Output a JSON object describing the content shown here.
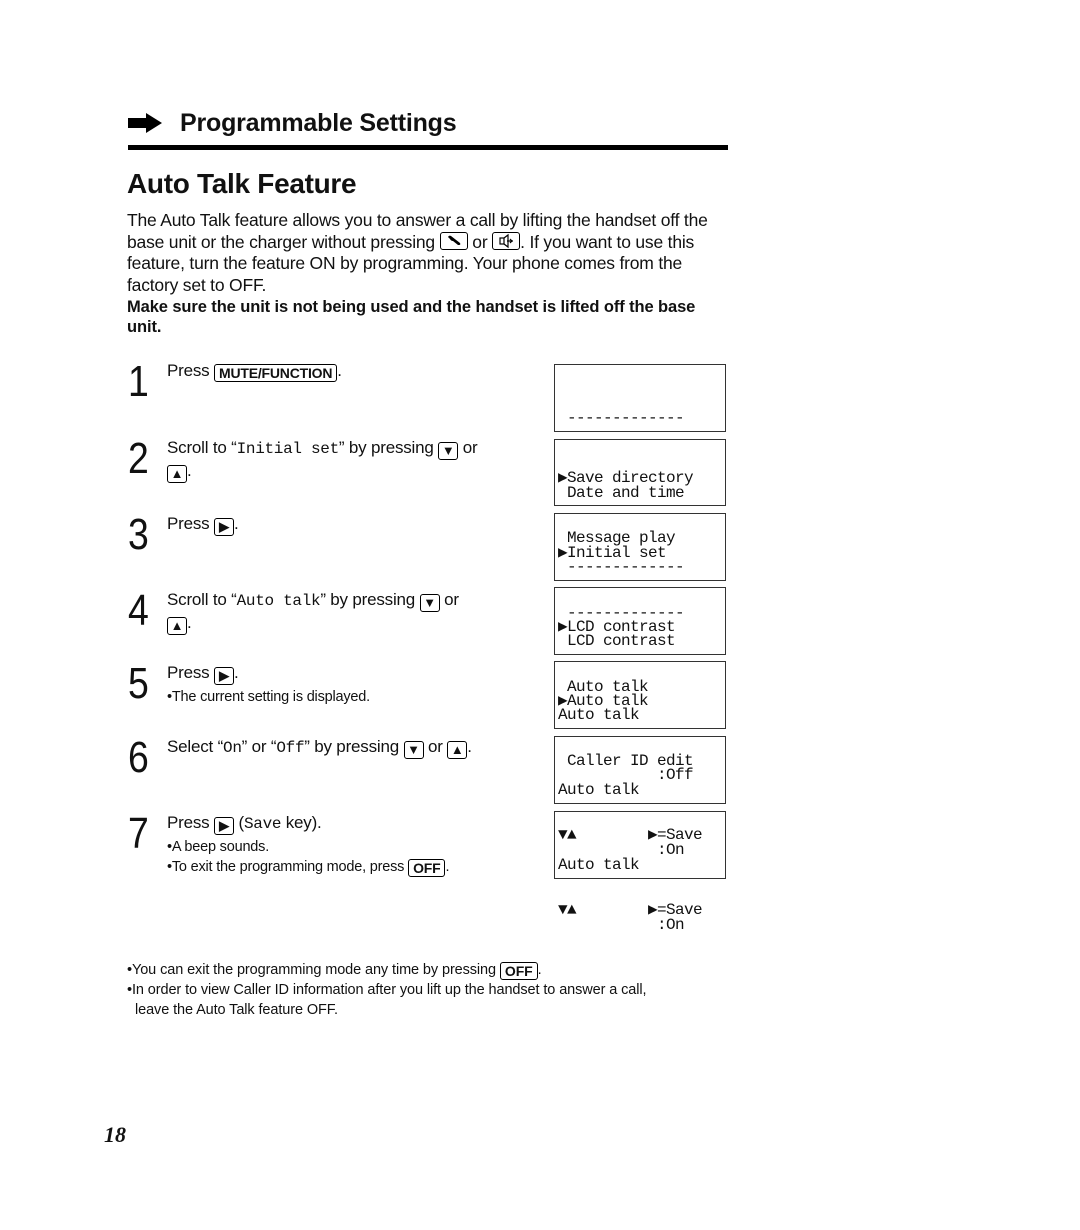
{
  "section": {
    "arrow_icon": "right-arrow-icon",
    "title": "Programmable Settings"
  },
  "page_title": "Auto Talk Feature",
  "intro": {
    "p1_a": "The Auto Talk feature allows you to answer a call by lifting the handset off the base unit or the charger without pressing ",
    "talk_key_icon": "phone-talk-icon",
    "or": " or ",
    "speaker_key_icon": "speakerphone-icon",
    "p1_b": ". If you want to use this feature, turn the feature ON by programming. Your phone comes from the factory set to OFF.",
    "warning": "Make sure the unit is not being used and the handset is lifted off the base unit."
  },
  "keys": {
    "mute_function": "MUTE/FUNCTION",
    "off": "OFF",
    "down": "▼",
    "up": "▲",
    "right": "▶"
  },
  "steps": [
    {
      "number": "1",
      "text_a": "Press ",
      "text_b": "."
    },
    {
      "number": "2",
      "text_a": "Scroll to “",
      "mono": "Initial set",
      "text_b": "” by pressing ",
      "text_c": " or ",
      "text_d": "."
    },
    {
      "number": "3",
      "text_a": "Press ",
      "text_b": "."
    },
    {
      "number": "4",
      "text_a": "Scroll to “",
      "mono": "Auto talk",
      "text_b": "” by pressing ",
      "text_c": " or ",
      "text_d": "."
    },
    {
      "number": "5",
      "text_a": "Press ",
      "text_b": ".",
      "note": "•The current setting is displayed."
    },
    {
      "number": "6",
      "text_a": "Select “",
      "mono1": "On",
      "text_b": "” or “",
      "mono2": "Off",
      "text_c": "” by pressing ",
      "text_d": " or ",
      "text_e": "."
    },
    {
      "number": "7",
      "text_a": "Press ",
      "text_b": " (",
      "mono": "Save",
      "text_c": " key).",
      "note1": "•A beep sounds.",
      "note2_a": "•To exit the programming mode, press ",
      "note2_b": "."
    }
  ],
  "displays": [
    {
      "lines": [
        " -------------",
        "▶Save directory",
        " Message play"
      ]
    },
    {
      "lines": [
        " Date and time",
        "▶Initial set",
        " -------------"
      ]
    },
    {
      "lines": [
        " -------------",
        "▶LCD contrast",
        " Auto talk"
      ]
    },
    {
      "lines": [
        " LCD contrast",
        "▶Auto talk",
        " Caller ID edit"
      ]
    },
    {
      "lines": [
        "Auto talk",
        "           :Off",
        "▼▲        ▶=Save"
      ]
    },
    {
      "lines": [
        "Auto talk",
        "           :On",
        "▼▲        ▶=Save"
      ]
    },
    {
      "lines": [
        "Auto talk",
        "           :On",
        ""
      ]
    }
  ],
  "footnotes": {
    "n1_a": "•You can exit the programming mode any time by pressing ",
    "n1_b": ".",
    "n2_a": "•In order to view Caller ID information after you lift up the handset to answer a call,",
    "n2_b": "leave the Auto Talk feature OFF."
  },
  "page_number": "18"
}
